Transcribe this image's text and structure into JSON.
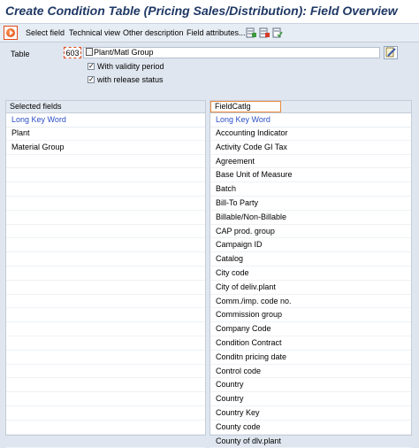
{
  "window": {
    "title": "Create Condition Table (Pricing Sales/Distribution): Field Overview"
  },
  "toolbar": {
    "select_field": "Select field",
    "technical_view": "Technical view",
    "other_description": "Other description",
    "field_attributes": "Field attributes..."
  },
  "form": {
    "table_label": "Table",
    "table_number": "603",
    "table_description": "Plant/Matl Group",
    "with_validity_period": "With validity period",
    "with_release_status": "with release status",
    "with_validity_checked": true,
    "with_release_checked": true
  },
  "selected_fields": {
    "header": "Selected fields",
    "column": "Long Key Word",
    "items": [
      "Plant",
      "Material Group"
    ]
  },
  "field_catalog": {
    "header": "FieldCatlg",
    "column": "Long Key Word",
    "items": [
      "Accounting Indicator",
      "Activity Code GI Tax",
      "Agreement",
      "Base Unit of Measure",
      "Batch",
      "Bill-To Party",
      "Billable/Non-Billable",
      "CAP prod. group",
      "Campaign ID",
      "Catalog",
      "City code",
      "City of deliv.plant",
      "Comm./imp. code no.",
      "Commission group",
      "Company Code",
      "Condition Contract",
      "Conditn pricing date",
      "Control code",
      "Country",
      "Country",
      "Country Key",
      "County code",
      "County of dlv.plant"
    ]
  },
  "colors": {
    "title": "#1f3864",
    "column_header": "#2b4ec9",
    "highlight": "#e04a1a"
  }
}
